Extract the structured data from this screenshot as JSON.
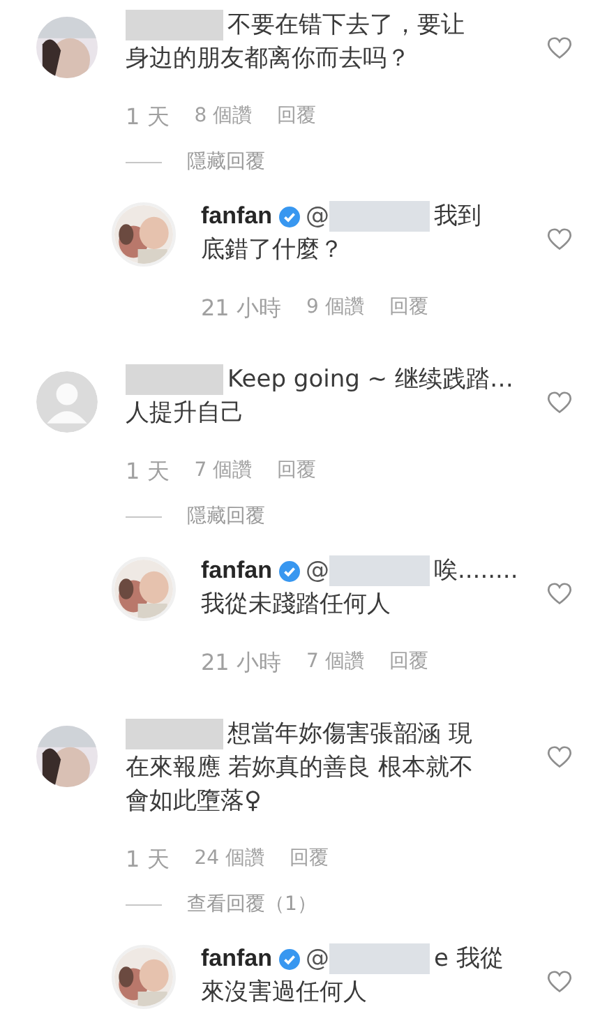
{
  "comments": [
    {
      "kind": "comment",
      "has_photo": true,
      "lines": [
        "不要在错下去了，要让",
        "身边的朋友都离你而去吗？"
      ],
      "time": "1 天",
      "likes": "8 個讚",
      "reply": "回覆",
      "thread_toggle": "隱藏回覆"
    },
    {
      "kind": "reply",
      "has_photo": true,
      "author": "fanfan",
      "verified": true,
      "mention": "@",
      "lines": [
        "我到",
        "底錯了什麼？"
      ],
      "time": "21 小時",
      "likes": "9 個讚",
      "reply": "回覆"
    },
    {
      "kind": "comment",
      "has_photo": false,
      "lines": [
        "Keep going ~ 继续践踏…",
        "人提升自己"
      ],
      "time": "1 天",
      "likes": "7 個讚",
      "reply": "回覆",
      "thread_toggle": "隱藏回覆"
    },
    {
      "kind": "reply",
      "has_photo": true,
      "author": "fanfan",
      "verified": true,
      "mention": "@",
      "lines": [
        "唉........",
        "我從未踐踏任何人"
      ],
      "time": "21 小時",
      "likes": "7 個讚",
      "reply": "回覆"
    },
    {
      "kind": "comment",
      "has_photo": true,
      "lines": [
        "想當年妳傷害張韶涵 現",
        "在來報應 若妳真的善良 根本就不",
        "會如此墮落♀"
      ],
      "time": "1 天",
      "likes": "24 個讚",
      "reply": "回覆",
      "thread_toggle": "查看回覆（1）"
    },
    {
      "kind": "reply",
      "has_photo": true,
      "author": "fanfan",
      "verified": true,
      "mention": "@",
      "lines": [
        "e 我從",
        "來沒害過任何人"
      ]
    }
  ]
}
